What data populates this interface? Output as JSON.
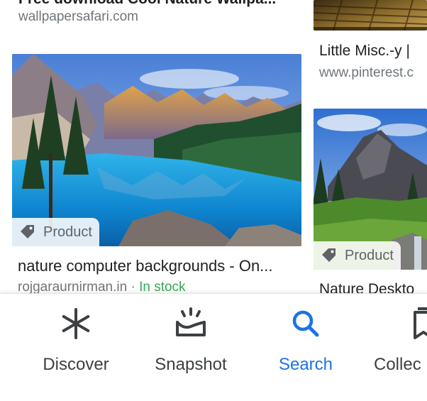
{
  "feed": {
    "top_left": {
      "title": "Free download Cool Nature Wallpa...",
      "source": "wallpapersafari.com"
    },
    "top_right": {
      "title": "Little Misc.-y |",
      "source": "www.pinterest.c"
    },
    "main_card": {
      "badge": "Product",
      "title": "nature computer backgrounds - On...",
      "source": "rojgaraurnirman.in",
      "separator": " · ",
      "stock": "In stock"
    },
    "right_card": {
      "badge": "Product",
      "title": "Nature Deskto"
    }
  },
  "nav": {
    "items": [
      {
        "label": "Discover",
        "icon": "asterisk-icon",
        "active": false
      },
      {
        "label": "Snapshot",
        "icon": "snapshot-icon",
        "active": false
      },
      {
        "label": "Search",
        "icon": "search-icon",
        "active": true
      },
      {
        "label": "Collec",
        "icon": "bookmark-icon",
        "active": false
      }
    ]
  },
  "colors": {
    "accent": "#1a73e8",
    "stock": "#34a853",
    "text": "#202124",
    "muted": "#70757a"
  }
}
